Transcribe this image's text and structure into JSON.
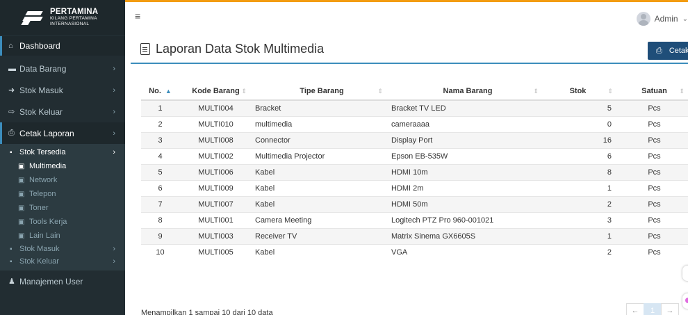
{
  "brand": {
    "name": "PERTAMINA",
    "line2": "KILANG PERTAMINA",
    "line3": "INTERNASIONAL"
  },
  "sidebar": {
    "items": [
      {
        "label": "Dashboard",
        "icon": "home-icon"
      },
      {
        "label": "Data Barang",
        "icon": "folder-icon"
      },
      {
        "label": "Stok Masuk",
        "icon": "sign-in-icon"
      },
      {
        "label": "Stok Keluar",
        "icon": "sign-out-icon"
      },
      {
        "label": "Cetak Laporan",
        "icon": "print-icon"
      }
    ],
    "submenu": {
      "stok_tersedia": "Stok Tersedia",
      "children": [
        "Multimedia",
        "Network",
        "Telepon",
        "Toner",
        "Tools Kerja",
        "Lain Lain"
      ],
      "stok_masuk": "Stok Masuk",
      "stok_keluar": "Stok Keluar"
    },
    "manajemen_user": "Manajemen User"
  },
  "topbar": {
    "menu_glyph": "≡",
    "user": "Admin"
  },
  "page": {
    "title": "Laporan Data Stok Multimedia",
    "print_label": "Cetak"
  },
  "table": {
    "headers": [
      "No.",
      "Kode Barang",
      "Tipe Barang",
      "Nama Barang",
      "Stok",
      "Satuan"
    ],
    "rows": [
      [
        "1",
        "MULTI004",
        "Bracket",
        "Bracket TV LED",
        "5",
        "Pcs"
      ],
      [
        "2",
        "MULTI010",
        "multimedia",
        "cameraaaa",
        "0",
        "Pcs"
      ],
      [
        "3",
        "MULTI008",
        "Connector",
        "Display Port",
        "16",
        "Pcs"
      ],
      [
        "4",
        "MULTI002",
        "Multimedia Projector",
        "Epson EB-535W",
        "6",
        "Pcs"
      ],
      [
        "5",
        "MULTI006",
        "Kabel",
        "HDMI 10m",
        "8",
        "Pcs"
      ],
      [
        "6",
        "MULTI009",
        "Kabel",
        "HDMI 2m",
        "1",
        "Pcs"
      ],
      [
        "7",
        "MULTI007",
        "Kabel",
        "HDMI 50m",
        "2",
        "Pcs"
      ],
      [
        "8",
        "MULTI001",
        "Camera Meeting",
        "Logitech PTZ Pro 960-001021",
        "3",
        "Pcs"
      ],
      [
        "9",
        "MULTI003",
        "Receiver TV",
        "Matrix Sinema GX6605S",
        "1",
        "Pcs"
      ],
      [
        "10",
        "MULTI005",
        "Kabel",
        "VGA",
        "2",
        "Pcs"
      ]
    ]
  },
  "footer": {
    "info": "Menampilkan 1 sampai 10 dari 10 data",
    "prev": "←",
    "page": "1",
    "next": "→"
  },
  "colors": {
    "sidebar": "#222d32",
    "accent": "#3c8dbc",
    "print_button": "#1f4e79",
    "topbar_border": "#f39c12"
  }
}
